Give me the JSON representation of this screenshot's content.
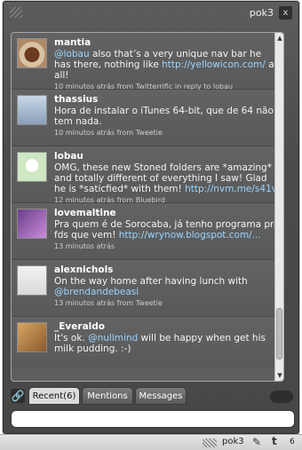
{
  "window": {
    "title": "pok3",
    "close_label": "x"
  },
  "tweets": [
    {
      "user": "mantia",
      "parts": [
        {
          "type": "link",
          "text": "@lobau"
        },
        {
          "type": "text",
          "text": " also that’s a very unique nav bar he has there, nothing like "
        },
        {
          "type": "link",
          "text": "http://yellowicon.com/"
        },
        {
          "type": "text",
          "text": " at all!"
        }
      ],
      "meta": "10 minutos atrás from Twitterrific in reply to lobau",
      "avatar": "coffee-cup-avatar"
    },
    {
      "user": "thassius",
      "parts": [
        {
          "type": "text",
          "text": "Hora de instalar o iTunes 64-bit, que de 64 não tem nada."
        }
      ],
      "meta": "10 minutos atrás from Tweetie",
      "avatar": "person-avatar"
    },
    {
      "user": "lobau",
      "parts": [
        {
          "type": "text",
          "text": "OMG, these new Stoned folders are *amazing* and totally different of everything I saw! Glad he is *saticfied* with them! "
        },
        {
          "type": "link",
          "text": "http://nvm.me/s41v"
        }
      ],
      "meta": "12 minutos atrás from Bluebird",
      "avatar": "cartoon-avatar"
    },
    {
      "user": "lovemaltine",
      "parts": [
        {
          "type": "text",
          "text": "Pra quem é de Sorocaba, já tenho programa pro fds que vem! "
        },
        {
          "type": "link",
          "text": "http://wrynow.blogspot.com/..."
        }
      ],
      "meta": "13 minutos atrás",
      "avatar": "purple-photo-avatar"
    },
    {
      "user": "alexnichols",
      "parts": [
        {
          "type": "text",
          "text": "On the way home after having lunch with "
        },
        {
          "type": "link",
          "text": "@brendandebeasi"
        }
      ],
      "meta": "13 minutos atrás from Tweetie",
      "avatar": "logo-avatar"
    },
    {
      "user": "_Everaldo",
      "parts": [
        {
          "type": "text",
          "text": "It's ok. "
        },
        {
          "type": "link",
          "text": "@nullmind"
        },
        {
          "type": "text",
          "text": " will be happy when get his milk pudding. :-)"
        }
      ],
      "meta": "",
      "avatar": "photo-avatar"
    }
  ],
  "tabs": [
    {
      "label": "Recent(6)",
      "active": true
    },
    {
      "label": "Mentions",
      "active": false
    },
    {
      "label": "Messages",
      "active": false
    }
  ],
  "compose": {
    "value": "",
    "placeholder": ""
  },
  "statusbar": {
    "title": "pok3",
    "count": "6"
  },
  "colors": {
    "link": "#9ad4ff",
    "panel": "#4f4f4f",
    "accent": "#5e5e5e"
  },
  "icons": {
    "link_icon": "link-icon",
    "close_icon": "close-icon"
  }
}
